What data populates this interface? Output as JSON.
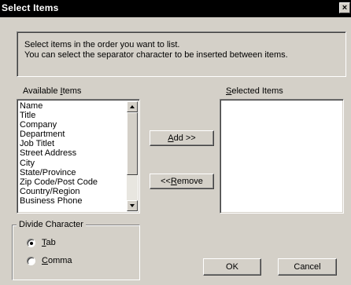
{
  "window": {
    "title": "Select Items",
    "close_label": "×"
  },
  "info": {
    "line1": "Select items in the order you want to list.",
    "line2": "You can select the separator character to be inserted between items."
  },
  "available": {
    "label_pre": "Available ",
    "label_u": "I",
    "label_post": "tems",
    "items": [
      "Name",
      "Title",
      "Company",
      "Department",
      "Job Titlet",
      "Street Address",
      "City",
      "State/Province",
      "Zip Code/Post Code",
      "Country/Region",
      "Business Phone"
    ]
  },
  "selected": {
    "label_u": "S",
    "label_post": "elected Items"
  },
  "buttons": {
    "add_u": "A",
    "add_post": "dd >>",
    "remove_pre": "<< ",
    "remove_u": "R",
    "remove_post": "emove",
    "ok": "OK",
    "cancel": "Cancel"
  },
  "divide": {
    "legend": "Divide Character",
    "tab_u": "T",
    "tab_post": "ab",
    "tab_selected": true,
    "comma_u": "C",
    "comma_post": "omma",
    "comma_selected": false
  }
}
